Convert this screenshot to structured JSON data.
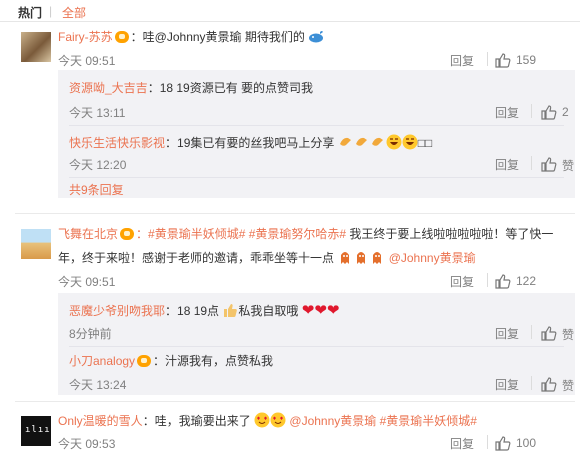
{
  "tabs": {
    "hot": "热门",
    "separator": "|",
    "all": "全部"
  },
  "actions": {
    "reply_label": "回复"
  },
  "comments": [
    {
      "user": "Fairy-苏苏",
      "text": "：哇@Johnny黄景瑜 期待我们的",
      "time": "今天 09:51",
      "likes": "159",
      "replies": [
        {
          "user": "资源呦_大吉吉",
          "text": "：18 19资源已有 要的点赞司我",
          "time": "今天 13:11",
          "likes": "2"
        },
        {
          "user": "快乐生活快乐影视",
          "text": "：19集已有要的丝我吧马上分享",
          "time": "今天 12:20",
          "likes": "赞"
        }
      ],
      "more": "共9条回复"
    },
    {
      "user": "飞舞在北京",
      "text_line1_tags": "：#黄景瑜半妖倾城# #黄景瑜努尔哈赤#",
      "text_line1_rest": " 我王终于要上线啦啦啦啦啦！等了快一",
      "text_line2": "年，终于来啦！感谢于老师的邀请，乖乖坐等十一点",
      "text_line2_mention": "@Johnny黄景瑜",
      "time": "今天 09:51",
      "likes": "122",
      "replies": [
        {
          "user": "恶魔少爷别吻我耶",
          "text": "：18 19点",
          "text_tail": "私我自取哦",
          "time": "8分钟前",
          "likes": "赞"
        },
        {
          "user": "小刀analogy",
          "text": "：汁源我有，点赞私我",
          "time": "今天 13:24",
          "likes": "赞"
        }
      ]
    },
    {
      "user": "Only温暖的雪人",
      "text": "：哇，我瑜要出来了",
      "mention": "@Johnny黄景瑜",
      "tag": "#黄景瑜半妖倾城#",
      "time": "今天 09:53",
      "likes": "100"
    }
  ],
  "colors": {
    "accent": "#eb7350",
    "muted": "#808080",
    "reply_bg": "#f2f2f5"
  }
}
